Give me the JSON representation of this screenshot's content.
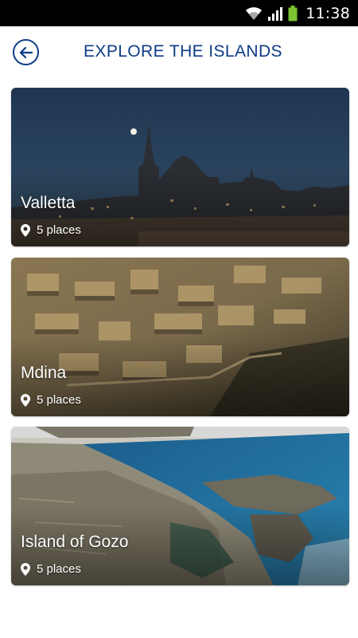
{
  "status_bar": {
    "time": "11:38",
    "icons": [
      "wifi-icon",
      "signal-icon",
      "battery-icon"
    ]
  },
  "header": {
    "title": "EXPLORE THE ISLANDS",
    "back_icon": "arrow-left-circle-icon"
  },
  "colors": {
    "accent": "#0d3c86",
    "battery": "#7ac231"
  },
  "places": [
    {
      "name": "Valletta",
      "count": "5 places",
      "icon": "location-pin-icon"
    },
    {
      "name": "Mdina",
      "count": "5 places",
      "icon": "location-pin-icon"
    },
    {
      "name": "Island of Gozo",
      "count": "5 places",
      "icon": "location-pin-icon"
    }
  ]
}
